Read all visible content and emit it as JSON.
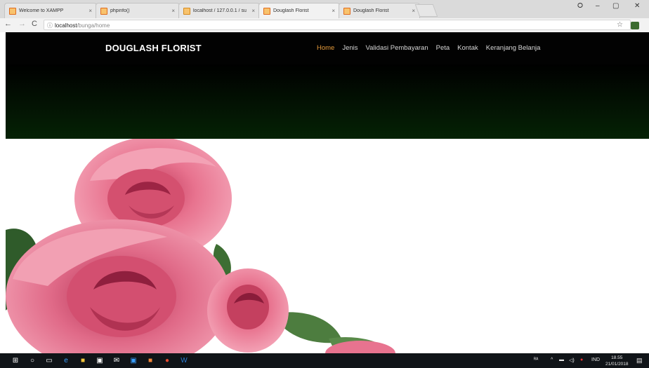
{
  "browser": {
    "tabs": [
      {
        "label": "Welcome to XAMPP",
        "active": false,
        "icon": "xampp-favicon"
      },
      {
        "label": "phpinfo()",
        "active": false,
        "icon": "php-favicon"
      },
      {
        "label": "localhost / 127.0.0.1 / su",
        "active": false,
        "icon": "phpmyadmin-favicon"
      },
      {
        "label": "Douglash Florist",
        "active": true,
        "icon": "site-favicon"
      },
      {
        "label": "Douglash Florist",
        "active": false,
        "icon": "site-favicon"
      }
    ],
    "address": {
      "host": "localhost",
      "path": "/bunga/home"
    }
  },
  "site": {
    "brand": "DOUGLASH FLORIST",
    "menu": [
      {
        "label": "Home",
        "active": true
      },
      {
        "label": "Jenis",
        "active": false
      },
      {
        "label": "Validasi Pembayaran",
        "active": false
      },
      {
        "label": "Peta",
        "active": false
      },
      {
        "label": "Kontak",
        "active": false
      },
      {
        "label": "Keranjang Belanja",
        "active": false
      }
    ],
    "colors": {
      "nav_bg": "#020202",
      "active_menu": "#e59a3a",
      "rose": "#e8738f"
    }
  },
  "taskbar": {
    "language": "IND",
    "time": "18.55",
    "date": "21/01/2018"
  }
}
